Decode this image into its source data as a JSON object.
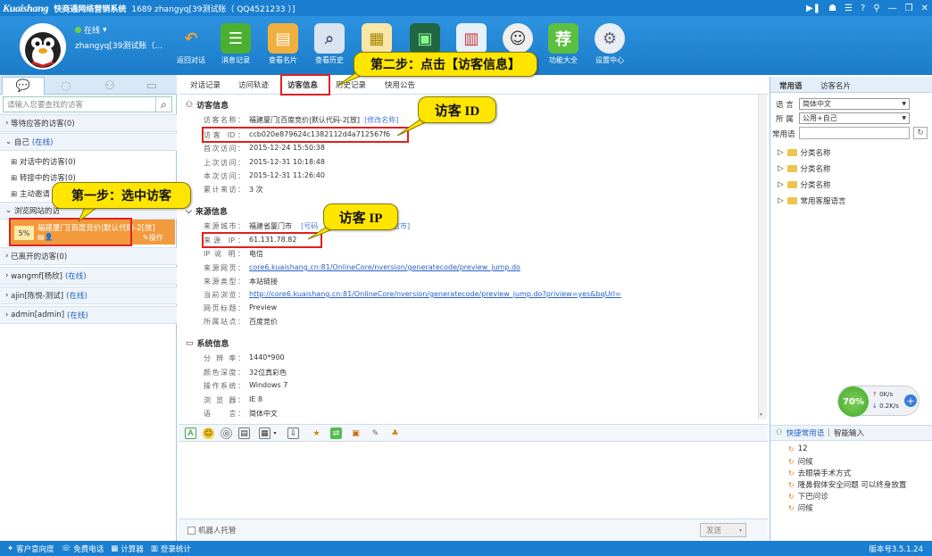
{
  "titlebar": {
    "logo": "Kuaishang",
    "title": "快商通网络营销系统",
    "user_line": "1689 zhangyq[39测试账（ QQ4521233 ）]",
    "controls": [
      "▶❚",
      "☗",
      "☰",
      "?",
      "⚲",
      "—",
      "❐",
      "✕"
    ]
  },
  "profile": {
    "status": "在线",
    "username": "zhangyq[39测试账（..."
  },
  "toolbar": {
    "items": [
      {
        "label": "返回对话",
        "icon": "↶"
      },
      {
        "label": "消息记录",
        "icon": "☰"
      },
      {
        "label": "查看名片",
        "icon": "▤"
      },
      {
        "label": "查看历史",
        "icon": "⌕"
      },
      {
        "label": "",
        "icon": "▦"
      },
      {
        "label": "",
        "icon": "▣"
      },
      {
        "label": "",
        "icon": "▥"
      },
      {
        "label": "",
        "icon": "☺"
      },
      {
        "label": "功能大全",
        "icon": "荐"
      },
      {
        "label": "设置中心",
        "icon": "⚙"
      }
    ]
  },
  "left": {
    "search_placeholder": "请输入您要查找的访客",
    "groups": {
      "waiting": "等待应答的访客(0)",
      "self": "自己",
      "self_status": "(在线)",
      "chatting": "对话中的访客(0)",
      "transferring": "转接中的访客(0)",
      "inviting": "主动邀请",
      "browsing": "浏览网站的访",
      "left": "已离开的访客(0)",
      "wangmf": "wangmf[杨欣]",
      "wangmf_status": "(在线)",
      "ajin": "ajin[陈悦-测试]",
      "ajin_status": "(在线)",
      "admin": "admin[admin]",
      "admin_status": "(在线)"
    },
    "visitor": {
      "percent": "5%",
      "name": "福建厦门[百度竞价|默认代码-2[放]",
      "action": "操作"
    }
  },
  "center": {
    "tabs": [
      "对话记录",
      "访问轨迹",
      "访客信息",
      "历史记录",
      "快用公告"
    ],
    "visitor_info": {
      "title": "访客信息",
      "name_label": "访客名称：",
      "name_value": "福建厦门[百度竞价|默认代码-2[放]",
      "edit_link": "[修改名称]",
      "id_label": "访客 ID：",
      "id_value": "ccb020e879624c1382112d4a712567f6",
      "first_label": "首次访问：",
      "first_value": "2015-12-24 15:50:38",
      "last_label": "上次访问：",
      "last_value": "2015-12-31 10:18:48",
      "this_label": "本次访问：",
      "this_value": "2015-12-31 11:26:40",
      "count_label": "累计来访：",
      "count_value": "3 次"
    },
    "source_info": {
      "title": "来源信息",
      "city_label": "来源城市：",
      "city_value": "福建省厦门市",
      "city_extra_a": "[号码",
      "city_extra_b": "省市]",
      "ip_label": "来源 IP：",
      "ip_value": "61.131.78.82",
      "ipdesc_label": "IP 说 明：",
      "ipdesc_value": "电信",
      "page_label": "来源网页：",
      "page_value": "core6.kuaishang.cn:81/OnlineCore/nversion/generatecode/preview_jump.do",
      "type_label": "来源类型：",
      "type_value": "本站链接",
      "current_label": "当前浏览：",
      "current_value": "http://core6.kuaishang.cn:81/OnlineCore/nversion/generatecode/preview_jump.do?priview=yes&bqUrl=",
      "title_label": "网页标题：",
      "title_value": "Preview",
      "site_label": "所属站点：",
      "site_value": "百度竞价"
    },
    "system_info": {
      "title": "系统信息",
      "res_label": "分 辨 率：",
      "res_value": "1440*900",
      "color_label": "颜色深度：",
      "color_value": "32位真彩色",
      "os_label": "操作系统：",
      "os_value": "Windows 7",
      "browser_label": "浏 览 器：",
      "browser_value": "IE 8",
      "lang_label": "语　　言：",
      "lang_value": "简体中文"
    },
    "robot_label": "机器人托管",
    "send_label": "发送"
  },
  "right": {
    "tabs": [
      "常用语",
      "访客名片"
    ],
    "lang_label": "语 言",
    "lang_value": "简体中文",
    "belong_label": "所 属",
    "belong_value": "公用+自己",
    "cy_label": "常用语",
    "tree": [
      "分类名称",
      "分类名称",
      "分类名称",
      "常用客服语言"
    ],
    "quick_label": "快捷常用语",
    "smart_label": "智能输入",
    "quick_items": [
      "12",
      "问候",
      "去眼袋手术方式",
      "隆鼻假体安全问题 可以终身放置",
      "下巴问诊",
      "问候"
    ]
  },
  "gauge": {
    "percent": "70%",
    "up": "0K/s",
    "down": "0.2K/s"
  },
  "statusbar": {
    "items": [
      "客户意向度",
      "免费电话",
      "计算器",
      "登录统计"
    ],
    "version": "版本号3.5.1.24"
  },
  "annotations": {
    "step1": "第一步：选中访客",
    "step2": "第二步：点击【访客信息】",
    "visitor_id": "访客 ID",
    "visitor_ip": "访客 IP"
  }
}
